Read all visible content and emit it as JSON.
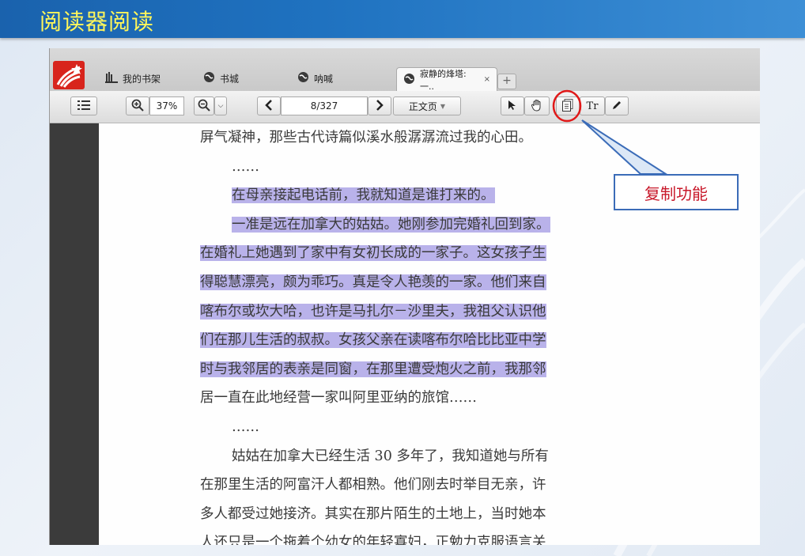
{
  "slide": {
    "title": "阅读器阅读"
  },
  "tabs": [
    {
      "label": "我的书架",
      "icon": "bookshelf-icon"
    },
    {
      "label": "书城",
      "icon": "globe-icon"
    },
    {
      "label": "呐喊",
      "icon": "globe-icon"
    },
    {
      "label": "寂静的烽塔:一..",
      "icon": "globe-icon",
      "active": true,
      "close": "×"
    }
  ],
  "tab_add": "+",
  "toolbar": {
    "zoom_value": "37%",
    "page_value": "8/327",
    "page_type": "正文页",
    "text_tool": "Tr"
  },
  "book_lines": [
    {
      "text": "屏气凝神，那些古代诗篇似溪水般潺潺流过我的心田。",
      "indent": false,
      "highlight": false
    },
    {
      "text": "……",
      "indent": true,
      "highlight": false
    },
    {
      "text": "在母亲接起电话前，我就知道是谁打来的。",
      "indent": true,
      "highlight": true
    },
    {
      "text": "一准是远在加拿大的姑姑。她刚参加完婚礼回到家。",
      "indent": true,
      "highlight": true
    },
    {
      "text": "在婚礼上她遇到了家中有女初长成的一家子。这女孩子生",
      "indent": false,
      "highlight": true
    },
    {
      "text": "得聪慧漂亮，颇为乖巧。真是令人艳羡的一家。他们来自",
      "indent": false,
      "highlight": true
    },
    {
      "text": "喀布尔或坎大哈，也许是马扎尔－沙里夫，我祖父认识他",
      "indent": false,
      "highlight": true
    },
    {
      "text": "们在那儿生活的叔叔。女孩父亲在读喀布尔哈比比亚中学",
      "indent": false,
      "highlight": true
    },
    {
      "text": "时与我邻居的表亲是同窗，在那里遭受炮火之前，我那邻",
      "indent": false,
      "highlight": true
    },
    {
      "text": "居一直在此地经营一家叫阿里亚纳的旅馆……",
      "indent": false,
      "highlight": false
    },
    {
      "text": "……",
      "indent": true,
      "highlight": false
    },
    {
      "text": "姑姑在加拿大已经生活 30 多年了，我知道她与所有",
      "indent": true,
      "highlight": false
    },
    {
      "text": "在那里生活的阿富汗人都相熟。他们刚去时举目无亲，许",
      "indent": false,
      "highlight": false
    },
    {
      "text": "多人都受过她接济。其实在那片陌生的土地上，当时她本",
      "indent": false,
      "highlight": false
    },
    {
      "text": "人还只是一个拖着个幼女的年轻寡妇，正勉力克服语言关",
      "indent": false,
      "highlight": false
    }
  ],
  "callout": {
    "label": "复制功能"
  },
  "colors": {
    "header": "#1f6fbe",
    "title": "#fff65a",
    "highlight": "#b9b2ea",
    "callout_text": "#c8182a",
    "callout_ring": "#e01818"
  }
}
